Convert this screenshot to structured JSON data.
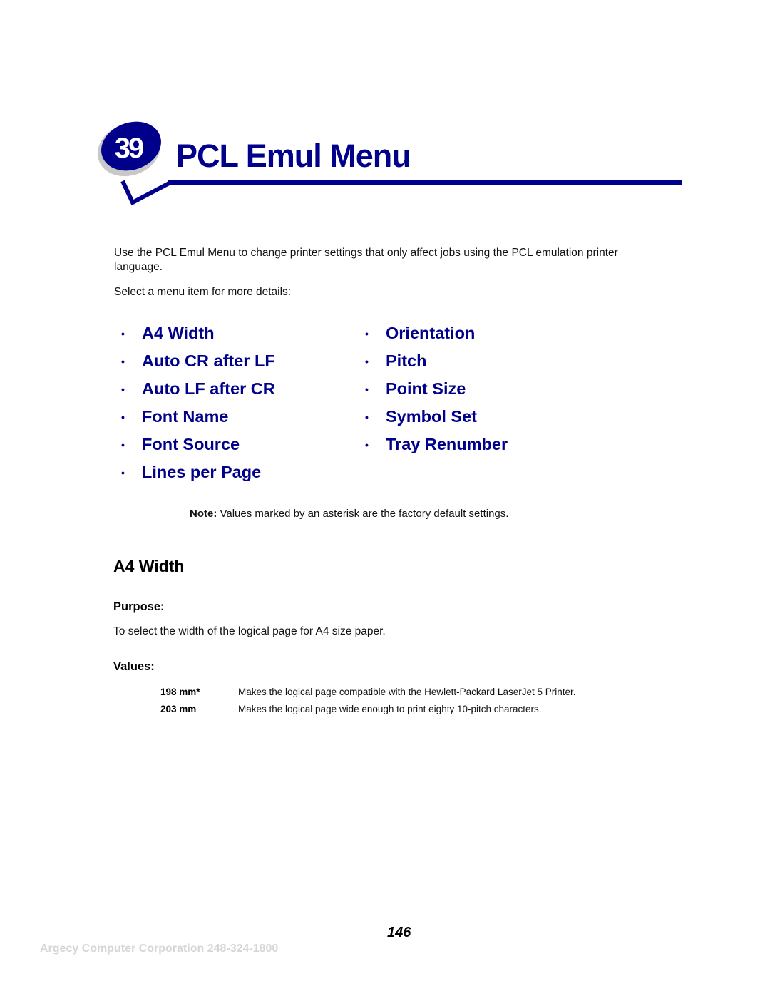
{
  "chapter": {
    "number": "39",
    "title": "PCL Emul Menu",
    "accent_color": "#00008b"
  },
  "intro": {
    "paragraph": "Use the PCL Emul Menu to change printer settings that only affect jobs using the PCL emulation printer language.",
    "select_hint": "Select a menu item for more details:"
  },
  "menu": {
    "bullet": "•",
    "left": [
      {
        "label": "A4 Width"
      },
      {
        "label": "Auto CR after LF"
      },
      {
        "label": "Auto LF after CR"
      },
      {
        "label": "Font Name"
      },
      {
        "label": "Font Source"
      },
      {
        "label": "Lines per Page"
      }
    ],
    "right": [
      {
        "label": "Orientation"
      },
      {
        "label": "Pitch"
      },
      {
        "label": "Point Size"
      },
      {
        "label": "Symbol Set"
      },
      {
        "label": "Tray Renumber"
      }
    ]
  },
  "note": {
    "label": "Note:",
    "text": " Values marked by an asterisk are the factory default settings."
  },
  "section": {
    "title": "A4 Width",
    "purpose_heading": "Purpose:",
    "purpose_text": "To select the width of the logical page for A4 size paper.",
    "values_heading": "Values:",
    "values": [
      {
        "key": "198 mm*",
        "desc": "Makes the logical page compatible with the Hewlett-Packard LaserJet 5 Printer."
      },
      {
        "key": "203 mm",
        "desc": "Makes the logical page wide enough to print eighty 10-pitch characters."
      }
    ]
  },
  "footer": {
    "page_number": "146",
    "company": "Argecy Computer Corporation 248-324-1800"
  }
}
